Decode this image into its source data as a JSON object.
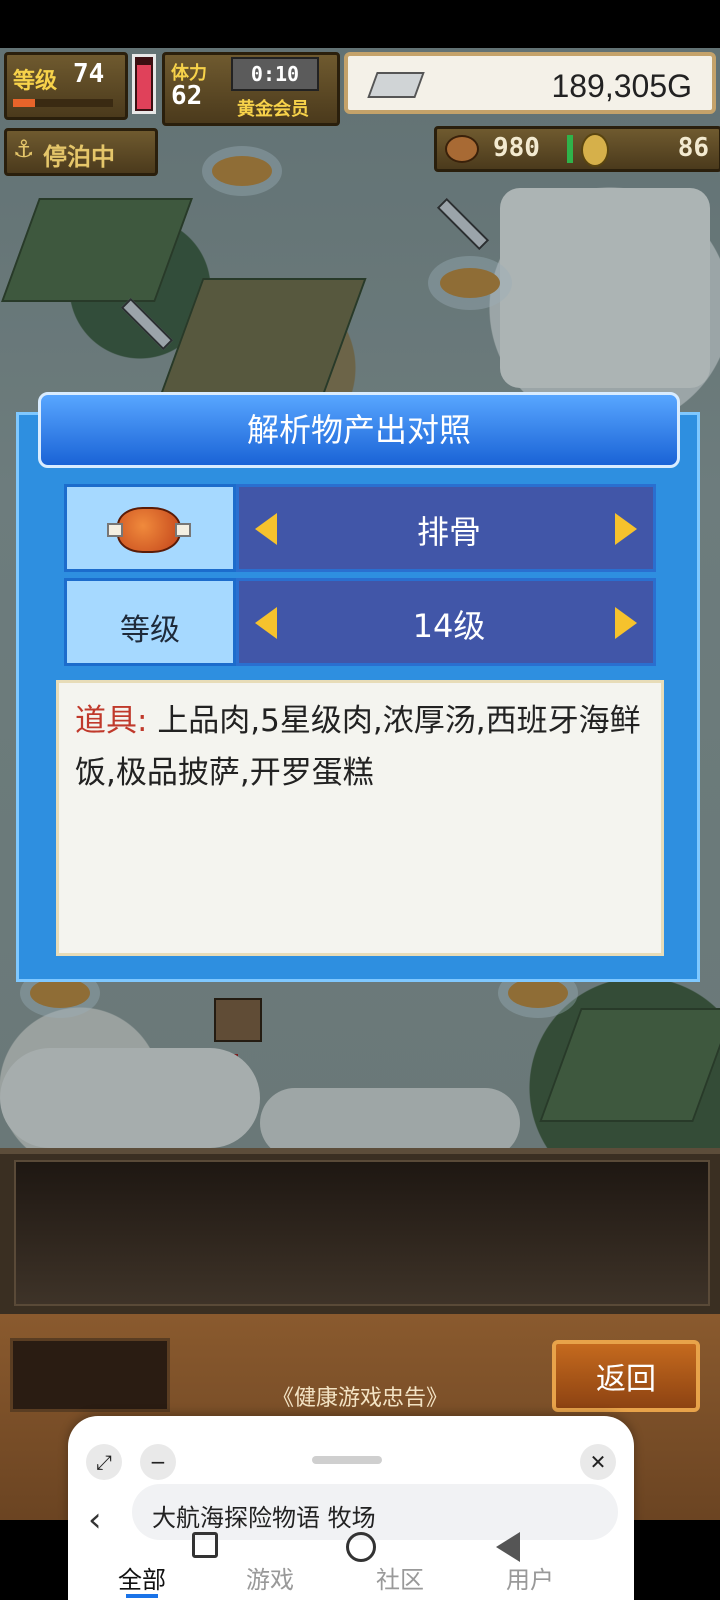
{
  "hud": {
    "level_label": "等级",
    "level_value": "74",
    "stamina_label": "体力",
    "stamina_value": "62",
    "timer": "0:10",
    "membership": "黄金会员",
    "gold": "189,305G",
    "status": "停泊中",
    "food_count": "980",
    "coin_count": "86"
  },
  "dialog": {
    "title": "解析物产出对照",
    "item_name": "排骨",
    "level_label": "等级",
    "level_value": "14级",
    "desc_label": "道具:",
    "desc_text": "上品肉,5星级肉,浓厚汤,西班牙海鲜饭,极品披萨,开罗蛋糕"
  },
  "footer": {
    "back_label": "返回",
    "notice": "《健康游戏忠告》"
  },
  "float_browser": {
    "search_text": "大航海探险物语 牧场",
    "tabs": [
      "全部",
      "游戏",
      "社区",
      "用户"
    ],
    "active_tab": "全部"
  },
  "colors": {
    "dialog_blue": "#2e8fe0",
    "title_blue": "#1a63d6",
    "value_blue": "#4156a8",
    "arrow_gold": "#f6c22d",
    "desc_label_red": "#c0392b",
    "back_orange": "#c56a1e"
  }
}
